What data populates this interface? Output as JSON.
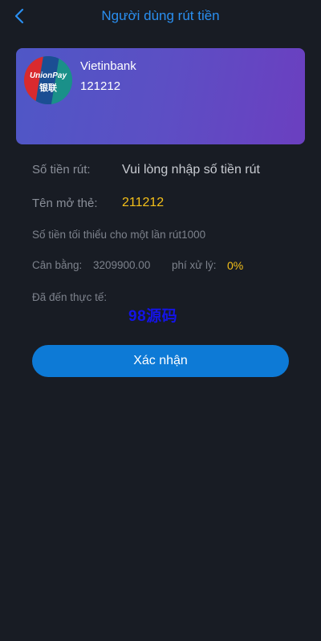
{
  "header": {
    "title": "Người dùng rút tiền",
    "back_icon": "chevron-left-icon"
  },
  "colors": {
    "accent": "#2a8ff0",
    "button": "#0d7ad6",
    "highlight": "#f5c019",
    "background": "#181c24",
    "card_gradient_start": "#4f57c6",
    "card_gradient_end": "#6b3fc0"
  },
  "card": {
    "logo_text_top": "UnionPay",
    "logo_text_bottom": "银联",
    "bank_name": "Vietinbank",
    "card_number": "121212"
  },
  "form": {
    "amount_label": "Số tiền rút:",
    "amount_placeholder": "Vui lòng nhập số tiền rút",
    "cardholder_label": "Tên mở thẻ:",
    "cardholder_value": "211212",
    "min_note": "Số tiền tối thiểu cho một lần rút1000",
    "balance_label": "Cân bằng:",
    "balance_value": "3209900.00",
    "fee_label": "phí xử lý:",
    "fee_value": "0%",
    "received_label": "Đã đến thực tế:",
    "watermark": "98源码"
  },
  "actions": {
    "confirm_label": "Xác nhận"
  }
}
